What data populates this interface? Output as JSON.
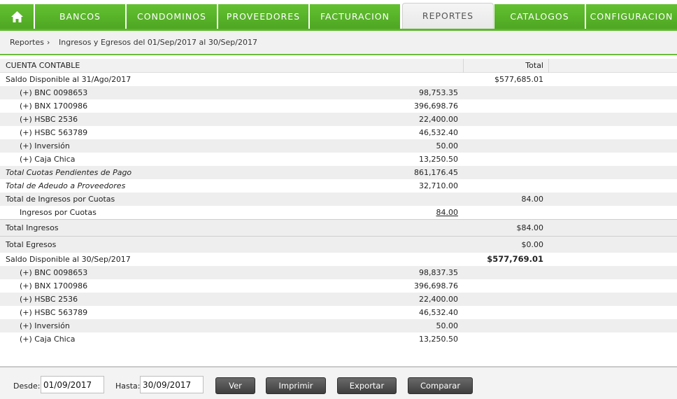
{
  "nav": {
    "tabs": [
      {
        "label": "BANCOS"
      },
      {
        "label": "CONDOMINOS"
      },
      {
        "label": "PROVEEDORES"
      },
      {
        "label": "FACTURACION"
      },
      {
        "label": "REPORTES"
      },
      {
        "label": "CATALOGOS"
      },
      {
        "label": "CONFIGURACION"
      }
    ],
    "active_tab": "REPORTES",
    "home_icon": "home-icon",
    "accent_color": "#5cb82c"
  },
  "breadcrumb": {
    "root": "Reportes",
    "separator": "›",
    "current": "Ingresos y Egresos del 01/Sep/2017 al 30/Sep/2017"
  },
  "report": {
    "headers": {
      "account": "CUENTA CONTABLE",
      "total": "Total"
    },
    "rows": [
      {
        "label": "Saldo Disponible al 31/Ago/2017",
        "sub": "",
        "total": "$577,685.01"
      },
      {
        "label": "(+) BNC 0098653",
        "sub": "98,753.35",
        "total": ""
      },
      {
        "label": "(+) BNX 1700986",
        "sub": "396,698.76",
        "total": ""
      },
      {
        "label": "(+) HSBC 2536",
        "sub": "22,400.00",
        "total": ""
      },
      {
        "label": "(+) HSBC 563789",
        "sub": "46,532.40",
        "total": ""
      },
      {
        "label": "(+) Inversión",
        "sub": "50.00",
        "total": ""
      },
      {
        "label": "(+) Caja Chica",
        "sub": "13,250.50",
        "total": ""
      },
      {
        "label": "Total Cuotas Pendientes de Pago",
        "sub": "861,176.45",
        "total": ""
      },
      {
        "label": "Total de Adeudo a Proveedores",
        "sub": "32,710.00",
        "total": ""
      },
      {
        "label": "Total de Ingresos por Cuotas",
        "sub": "",
        "total": "84.00"
      },
      {
        "label": "Ingresos por Cuotas",
        "sub": "84.00",
        "total": ""
      }
    ],
    "total_ingresos": {
      "label": "Total Ingresos",
      "total": "$84.00"
    },
    "total_egresos": {
      "label": "Total Egresos",
      "total": "$0.00"
    },
    "rows_end": [
      {
        "label": "Saldo Disponible al 30/Sep/2017",
        "sub": "",
        "total": "$577,769.01"
      },
      {
        "label": "(+) BNC 0098653",
        "sub": "98,837.35",
        "total": ""
      },
      {
        "label": "(+) BNX 1700986",
        "sub": "396,698.76",
        "total": ""
      },
      {
        "label": "(+) HSBC 2536",
        "sub": "22,400.00",
        "total": ""
      },
      {
        "label": "(+) HSBC 563789",
        "sub": "46,532.40",
        "total": ""
      },
      {
        "label": "(+) Inversión",
        "sub": "50.00",
        "total": ""
      },
      {
        "label": "(+) Caja Chica",
        "sub": "13,250.50",
        "total": ""
      }
    ]
  },
  "filters": {
    "desde_label": "Desde:",
    "desde_value": "01/09/2017",
    "hasta_label": "Hasta:",
    "hasta_value": "30/09/2017",
    "buttons": {
      "ver": "Ver",
      "imprimir": "Imprimir",
      "exportar": "Exportar",
      "comparar": "Comparar"
    }
  }
}
